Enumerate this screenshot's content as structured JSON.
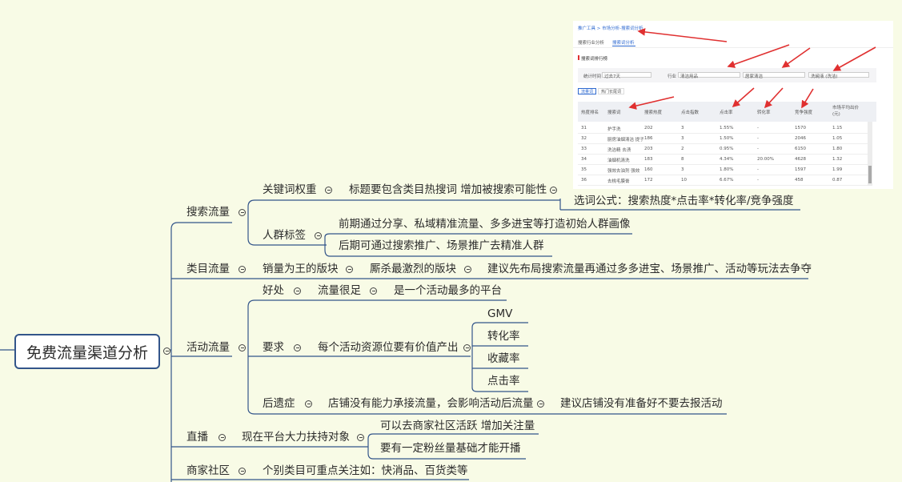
{
  "mindmap": {
    "root": "免费流量渠道分析",
    "search": {
      "label": "搜索流量",
      "keyword": {
        "label": "关键词权重",
        "detail": "标题要包含类目热搜词 增加被搜索可能性",
        "formula": "选词公式：搜索热度*点击率*转化率/竞争强度"
      },
      "crowd": {
        "label": "人群标签",
        "early": "前期通过分享、私域精准流量、多多进宝等打造初始人群画像",
        "later": "后期可通过搜索推广、场景推广去精准人群"
      }
    },
    "category": {
      "label": "类目流量",
      "c1": "销量为王的版块",
      "c2": "厮杀最激烈的版块",
      "c3": "建议先布局搜索流量再通过多多进宝、场景推广、活动等玩法去争夺"
    },
    "activity": {
      "label": "活动流量",
      "benefit": {
        "label": "好处",
        "v1": "流量很足",
        "v2": "是一个活动最多的平台"
      },
      "require": {
        "label": "要求",
        "detail": "每个活动资源位要有价值产出",
        "metrics": [
          "GMV",
          "转化率",
          "收藏率",
          "点击率"
        ]
      },
      "after": {
        "label": "后遗症",
        "v1": "店铺没有能力承接流量，会影响活动后流量",
        "v2": "建议店铺没有准备好不要去报活动"
      }
    },
    "live": {
      "label": "直播",
      "detail": "现在平台大力扶持对象",
      "d1": "可以去商家社区活跃 增加关注量",
      "d2": "要有一定粉丝量基础才能开播"
    },
    "community": {
      "label": "商家社区",
      "detail": "个别类目可重点关注如：快消品、百货类等"
    }
  },
  "screenshot": {
    "breadcrumb": "推广工具 > 市场分析-搜索词分析",
    "tabs": [
      "搜索行业分析",
      "搜索词分析"
    ],
    "section_title": "搜索词排行榜",
    "filters": {
      "time_label": "统计时间",
      "time_value": "过去7天",
      "industry_label": "行业",
      "industry_value": "清洁用品",
      "sub_value": "居家清洁",
      "third_value": "洗碗液 (洗洁)"
    },
    "toggle": [
      "流量词",
      "热门长尾词"
    ],
    "columns": [
      "热度排名",
      "搜索词",
      "搜索热度",
      "点击指数",
      "点击率",
      "转化率",
      "竞争强度",
      "市场平均出价 (元)"
    ],
    "rows": [
      [
        "31",
        "护手洗",
        "202",
        "3",
        "1.55%",
        "-",
        "1570",
        "1.15"
      ],
      [
        "32",
        "厨房油烟清洁 提子",
        "186",
        "3",
        "1.50%",
        "-",
        "2046",
        "1.05"
      ],
      [
        "33",
        "洗洁精 去渍",
        "203",
        "2",
        "0.95%",
        "-",
        "6150",
        "1.80"
      ],
      [
        "34",
        "油烟机清洗",
        "183",
        "8",
        "4.34%",
        "20.00%",
        "4628",
        "1.32"
      ],
      [
        "35",
        "强效去油剂 强效",
        "160",
        "3",
        "1.80%",
        "-",
        "1597",
        "1.99"
      ],
      [
        "36",
        "去桃毛膜膏",
        "172",
        "10",
        "6.67%",
        "-",
        "458",
        "0.87"
      ]
    ],
    "colors": {
      "link": "#2f6ad0",
      "arrow": "#e03030",
      "accent_bar": "#e03030"
    }
  },
  "colors": {
    "background": "#f8fbe6",
    "root_border": "#33558a",
    "line": "#33558a"
  }
}
